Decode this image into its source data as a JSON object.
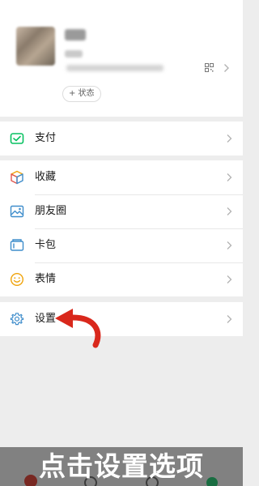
{
  "profile": {
    "nickname": "昵称",
    "wechat_id": "微信号",
    "status_label": "+ 状态"
  },
  "menu": {
    "pay": {
      "label": "支付",
      "icon": "pay-icon"
    },
    "favorites": {
      "label": "收藏",
      "icon": "cube-icon"
    },
    "moments": {
      "label": "朋友圈",
      "icon": "image-icon"
    },
    "cards": {
      "label": "卡包",
      "icon": "wallet-icon"
    },
    "stickers": {
      "label": "表情",
      "icon": "smiley-icon"
    },
    "settings": {
      "label": "设置",
      "icon": "gear-icon"
    }
  },
  "caption": {
    "text": "点击设置选项"
  },
  "colors": {
    "pay_green": "#07c160",
    "settings_blue": "#3f8dcb",
    "sticker_orange": "#f0a30a",
    "arrow_red": "#d9281c",
    "background": "#ededed"
  }
}
